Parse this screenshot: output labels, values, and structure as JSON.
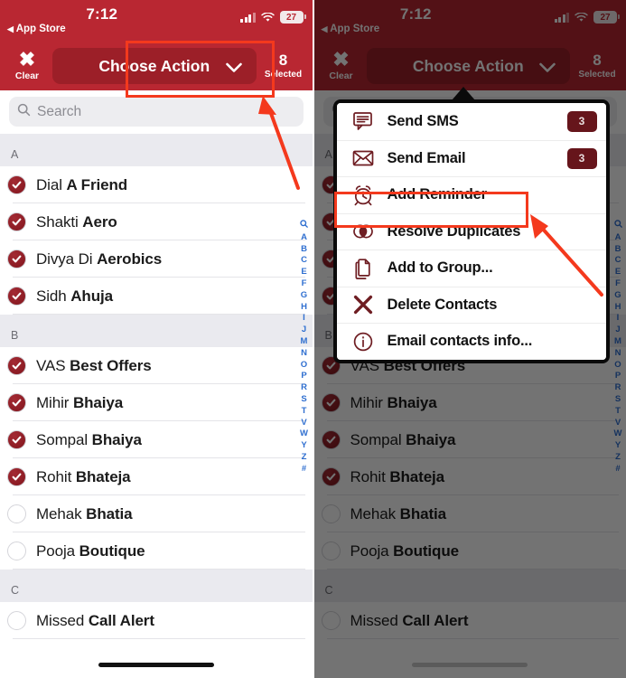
{
  "status_bar": {
    "time": "7:12",
    "back_label": "App Store",
    "back_arrow": "◀",
    "battery_percent": "27",
    "signal_icon": "cellular-bars-icon",
    "wifi_icon": "wifi-icon",
    "battery_icon": "battery-icon"
  },
  "action_bar": {
    "clear_icon": "close-x-icon",
    "clear_label": "Clear",
    "choose_action_label": "Choose Action",
    "chevron_icon": "chevron-down-icon",
    "selected_count": "8",
    "selected_label": "Selected"
  },
  "search": {
    "placeholder": "Search",
    "icon": "search-icon"
  },
  "sections": [
    {
      "letter": "A",
      "contacts": [
        {
          "first": "Dial ",
          "last": "A Friend",
          "checked": true
        },
        {
          "first": "Shakti ",
          "last": "Aero",
          "checked": true
        },
        {
          "first": "Divya Di ",
          "last": "Aerobics",
          "checked": true
        },
        {
          "first": "Sidh ",
          "last": "Ahuja",
          "checked": true
        }
      ]
    },
    {
      "letter": "B",
      "contacts": [
        {
          "first": "VAS ",
          "last": "Best Offers",
          "checked": true
        },
        {
          "first": "Mihir ",
          "last": "Bhaiya",
          "checked": true
        },
        {
          "first": "Sompal ",
          "last": "Bhaiya",
          "checked": true
        },
        {
          "first": "Rohit ",
          "last": "Bhateja",
          "checked": true
        },
        {
          "first": "Mehak ",
          "last": "Bhatia",
          "checked": false
        },
        {
          "first": "Pooja ",
          "last": "Boutique",
          "checked": false
        }
      ]
    },
    {
      "letter": "C",
      "contacts": [
        {
          "first": "Missed ",
          "last": "Call Alert",
          "checked": false
        }
      ]
    }
  ],
  "index_strip": {
    "search_icon": "search-index-icon",
    "letters": [
      "A",
      "B",
      "C",
      "E",
      "F",
      "G",
      "H",
      "I",
      "J",
      "M",
      "N",
      "O",
      "P",
      "R",
      "S",
      "T",
      "V",
      "W",
      "Y",
      "Z",
      "#"
    ]
  },
  "menu": {
    "items": [
      {
        "label": "Send SMS",
        "icon": "sms-bubble-icon",
        "badge": "3"
      },
      {
        "label": "Send Email",
        "icon": "envelope-icon",
        "badge": "3"
      },
      {
        "label": "Add Reminder",
        "icon": "alarm-clock-icon",
        "badge": ""
      },
      {
        "label": "Resolve Duplicates",
        "icon": "venn-circles-icon",
        "badge": ""
      },
      {
        "label": "Add to Group...",
        "icon": "documents-icon",
        "badge": ""
      },
      {
        "label": "Delete Contacts",
        "icon": "x-cross-icon",
        "badge": ""
      },
      {
        "label": "Email contacts info...",
        "icon": "info-circle-icon",
        "badge": ""
      }
    ]
  },
  "colors": {
    "header_red": "#b92732",
    "choose_button_red": "#9c1f28",
    "checkbox_red": "#8c1c24",
    "menu_icon_maroon": "#6e1d22",
    "badge_maroon": "#66151b",
    "index_blue": "#2f6fd0",
    "annotation_red": "#f4391d",
    "section_header_bg": "#eaeaef"
  },
  "annotations": {
    "left_highlight": "choose-action-button",
    "right_highlight": "delete-contacts-item"
  }
}
